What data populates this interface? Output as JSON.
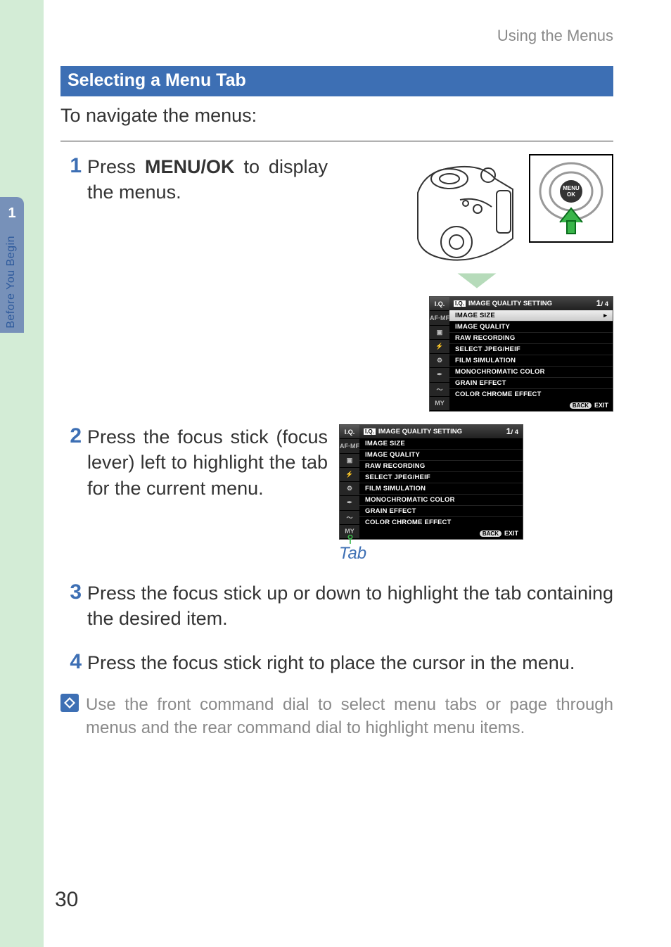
{
  "running_head": "Using the Menus",
  "side_tab": {
    "num": "1",
    "label": "Before You Begin"
  },
  "section_title": "Selecting a Menu Tab",
  "intro": "To navigate the menus:",
  "steps": {
    "s1": {
      "num": "1",
      "pre": "Press ",
      "kw": "MENU/OK",
      "post": " to display the menus."
    },
    "s2": {
      "num": "2",
      "text": "Press the focus stick (focus lever) left to highlight the tab for the current menu."
    },
    "s3": {
      "num": "3",
      "text": "Press the focus stick up or down to highlight the tab containing the desired item."
    },
    "s4": {
      "num": "4",
      "text": "Press the focus stick right to place the cursor in the menu."
    }
  },
  "button_label": "MENU\nOK",
  "menu": {
    "header_badge": "I.Q.",
    "header_title": "IMAGE QUALITY SETTING",
    "page": "1",
    "page_total": "/ 4",
    "items": [
      "IMAGE SIZE",
      "IMAGE QUALITY",
      "RAW RECORDING",
      "SELECT JPEG/HEIF",
      "FILM SIMULATION",
      "MONOCHROMATIC COLOR",
      "GRAIN EFFECT",
      "COLOR CHROME EFFECT"
    ],
    "tabs": [
      "I.Q.",
      "AF·MF",
      "▣",
      "⚡",
      "⚙",
      "✒",
      "〜",
      "MY"
    ],
    "footer_pill": "BACK",
    "footer_text": "EXIT"
  },
  "tab_caption": "Tab",
  "note": "Use the front command dial to select menu tabs or page through menus and the rear command dial to highlight menu items.",
  "page_number": "30"
}
